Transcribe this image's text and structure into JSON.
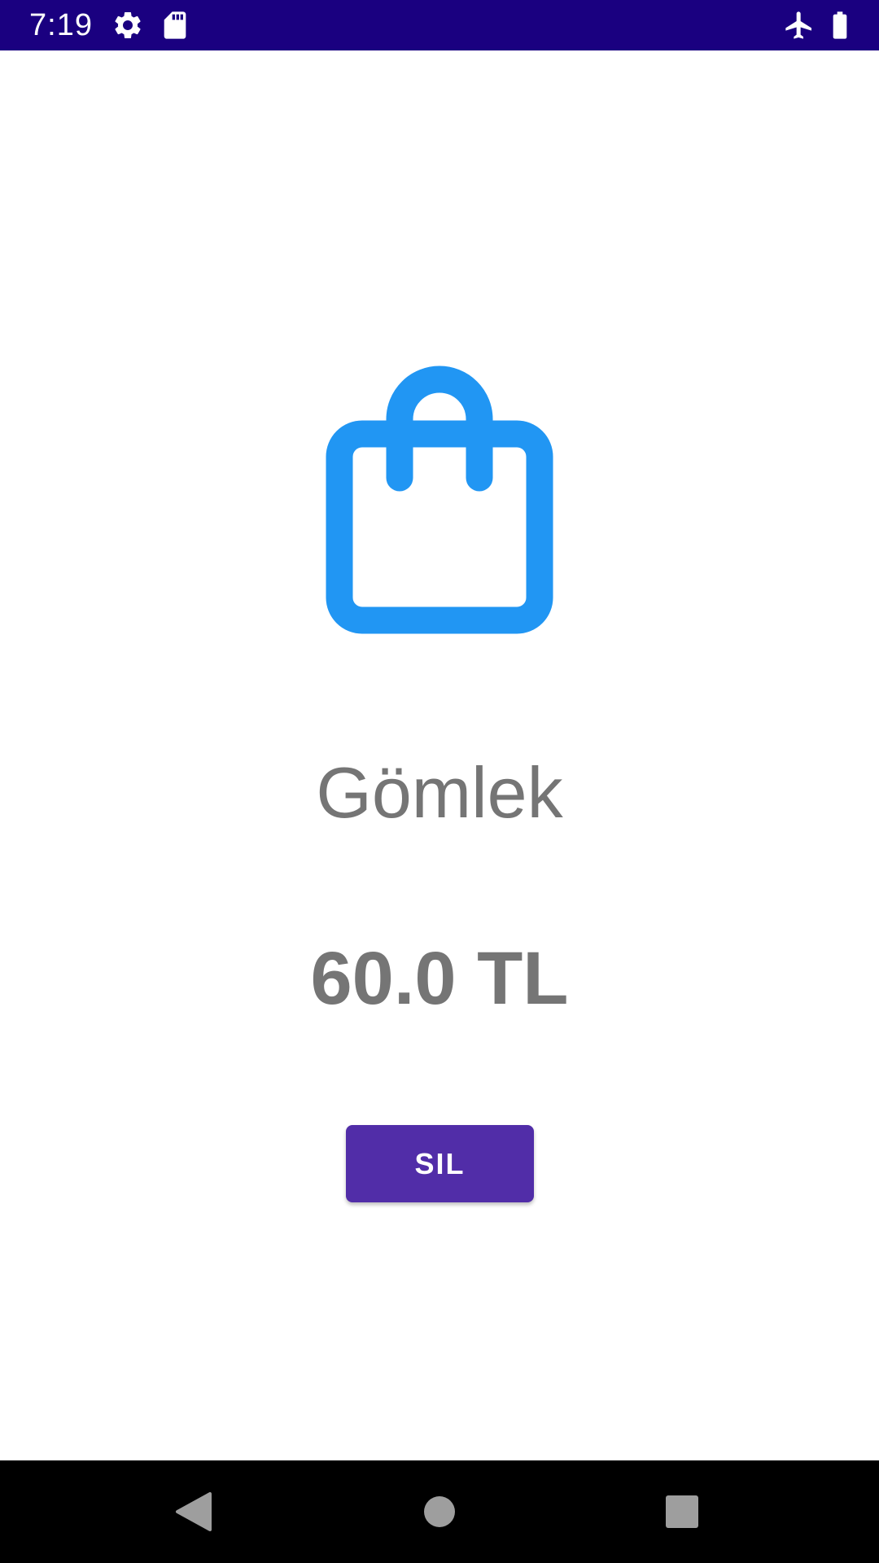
{
  "status_bar": {
    "time": "7:19",
    "icons": [
      "gear-icon",
      "sd-card-icon",
      "airplane-icon",
      "battery-icon"
    ],
    "background": "#1a0080"
  },
  "product": {
    "icon": "shopping-bag-icon",
    "icon_color": "#2196f3",
    "name": "Gömlek",
    "price": "60.0 TL"
  },
  "actions": {
    "delete_label": "SIL",
    "button_color": "#512da8"
  },
  "nav_bar": {
    "buttons": [
      "back-icon",
      "home-icon",
      "recents-icon"
    ]
  }
}
